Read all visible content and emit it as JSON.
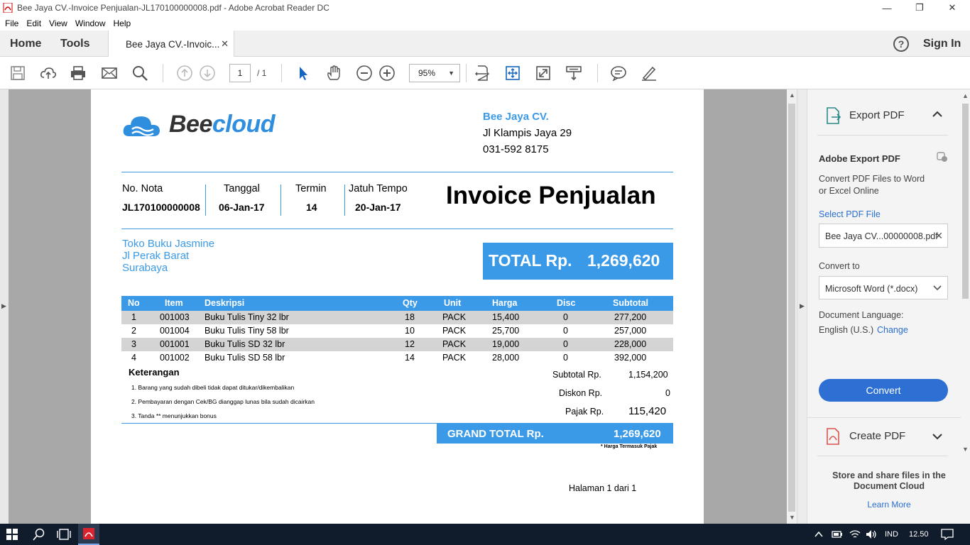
{
  "window": {
    "title": "Bee Jaya CV.-Invoice Penjualan-JL170100000008.pdf - Adobe Acrobat Reader DC",
    "minimize": "—",
    "maximize": "❐",
    "close": "✕"
  },
  "menu": [
    "File",
    "Edit",
    "View",
    "Window",
    "Help"
  ],
  "tabs": {
    "home": "Home",
    "tools": "Tools",
    "document": "Bee Jaya CV.-Invoic...",
    "close": "✕",
    "help": "?",
    "signin": "Sign In"
  },
  "toolbar": {
    "page_current": "1",
    "page_total": "/ 1",
    "zoom": "95%",
    "zoom_arrow": "▼"
  },
  "invoice": {
    "brand_name_part1": "Bee",
    "brand_name_part2": "cloud",
    "company_name": "Bee Jaya CV.",
    "company_address": "Jl Klampis Jaya 29",
    "company_phone": "031-592 8175",
    "title": "Invoice Penjualan",
    "meta": {
      "nota_label": "No. Nota",
      "nota_value": "JL170100000008",
      "tanggal_label": "Tanggal",
      "tanggal_value": "06-Jan-17",
      "termin_label": "Termin",
      "termin_value": "14",
      "jatuh_tempo_label": "Jatuh Tempo",
      "jatuh_tempo_value": "20-Jan-17"
    },
    "customer": {
      "name": "Toko Buku Jasmine",
      "address": "Jl Perak Barat",
      "city": "Surabaya"
    },
    "total_label": "TOTAL Rp.",
    "total_value": "1,269,620",
    "columns": [
      "No",
      "Item",
      "Deskripsi",
      "Qty",
      "Unit",
      "Harga",
      "Disc",
      "Subtotal"
    ],
    "rows": [
      {
        "no": "1",
        "item": "001003",
        "desc": "Buku Tulis Tiny 32 lbr",
        "qty": "18",
        "unit": "PACK",
        "harga": "15,400",
        "disc": "0",
        "subtotal": "277,200"
      },
      {
        "no": "2",
        "item": "001004",
        "desc": "Buku Tulis Tiny 58 lbr",
        "qty": "10",
        "unit": "PACK",
        "harga": "25,700",
        "disc": "0",
        "subtotal": "257,000"
      },
      {
        "no": "3",
        "item": "001001",
        "desc": "Buku Tulis SD 32 lbr",
        "qty": "12",
        "unit": "PACK",
        "harga": "19,000",
        "disc": "0",
        "subtotal": "228,000"
      },
      {
        "no": "4",
        "item": "001002",
        "desc": "Buku Tulis SD 58 lbr",
        "qty": "14",
        "unit": "PACK",
        "harga": "28,000",
        "disc": "0",
        "subtotal": "392,000"
      }
    ],
    "keterangan_label": "Keterangan",
    "notes": [
      "1. Barang yang sudah dibeli tidak dapat ditukar/dikembalikan",
      "2. Pembayaran dengan Cek/BG dianggap lunas bila sudah dicairkan",
      "3. Tanda ** menunjukkan bonus"
    ],
    "subtotal_label": "Subtotal Rp.",
    "subtotal_value": "1,154,200",
    "diskon_label": "Diskon Rp.",
    "diskon_value": "0",
    "pajak_label": "Pajak Rp.",
    "pajak_value": "115,420",
    "grand_total_label": "GRAND TOTAL Rp.",
    "grand_total_value": "1,269,620",
    "tax_note": "* Harga Termasuk Pajak",
    "page_footer": "Halaman 1 dari  1"
  },
  "panel": {
    "export_title": "Export PDF",
    "adobe_export_title": "Adobe Export PDF",
    "description_line1": "Convert PDF Files to Word",
    "description_line2": "or Excel Online",
    "select_label": "Select PDF File",
    "selected_file": "Bee Jaya CV...00000008.pdf",
    "convert_to_label": "Convert to",
    "convert_to_value": "Microsoft Word (*.docx)",
    "language_label": "Document Language:",
    "language_value": "English (U.S.)",
    "change_link": "Change",
    "convert_button": "Convert",
    "create_pdf": "Create PDF",
    "cloud_line1": "Store and share files in the",
    "cloud_line2": "Document Cloud",
    "learn_more": "Learn More"
  },
  "taskbar": {
    "language": "IND",
    "time": "12.50"
  },
  "colors": {
    "accent_blue": "#3b9ae8",
    "button_blue": "#2d6fd3",
    "taskbar": "#101c2c"
  }
}
